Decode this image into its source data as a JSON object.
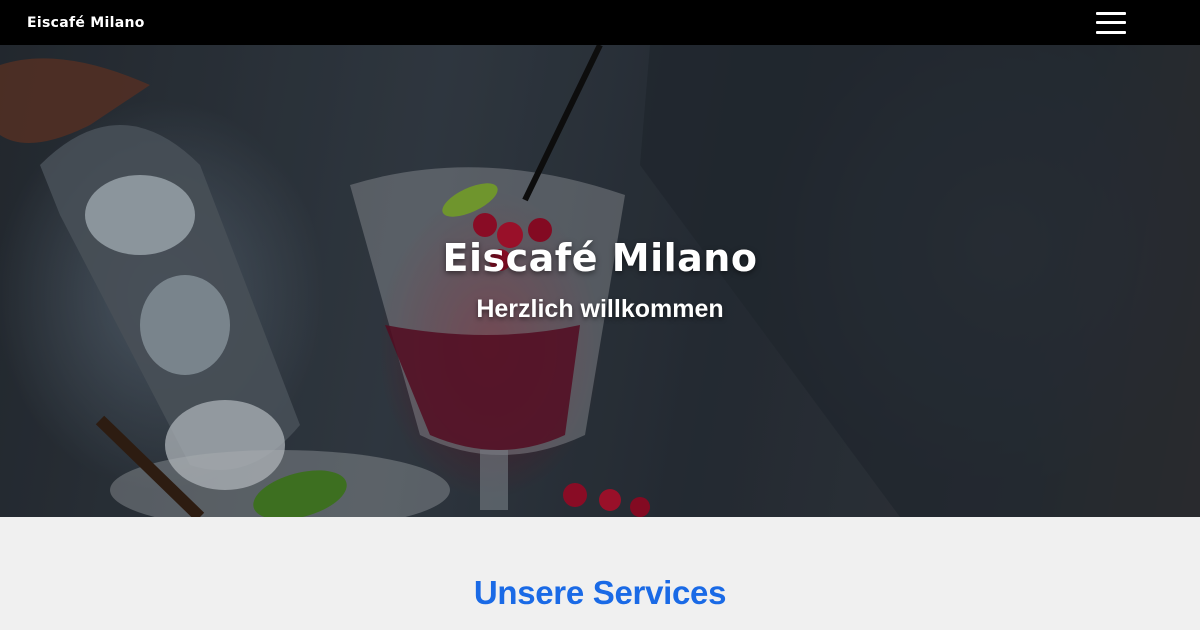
{
  "navbar": {
    "brand": "Eiscafé Milano",
    "menu_icon": "hamburger-menu-icon"
  },
  "hero": {
    "title": "Eiscafé Milano",
    "subtitle": "Herzlich willkommen"
  },
  "services": {
    "heading": "Unsere Services"
  },
  "colors": {
    "navbar_bg": "#000000",
    "accent": "#1a6ae6",
    "section_bg": "#f0f0f0"
  }
}
